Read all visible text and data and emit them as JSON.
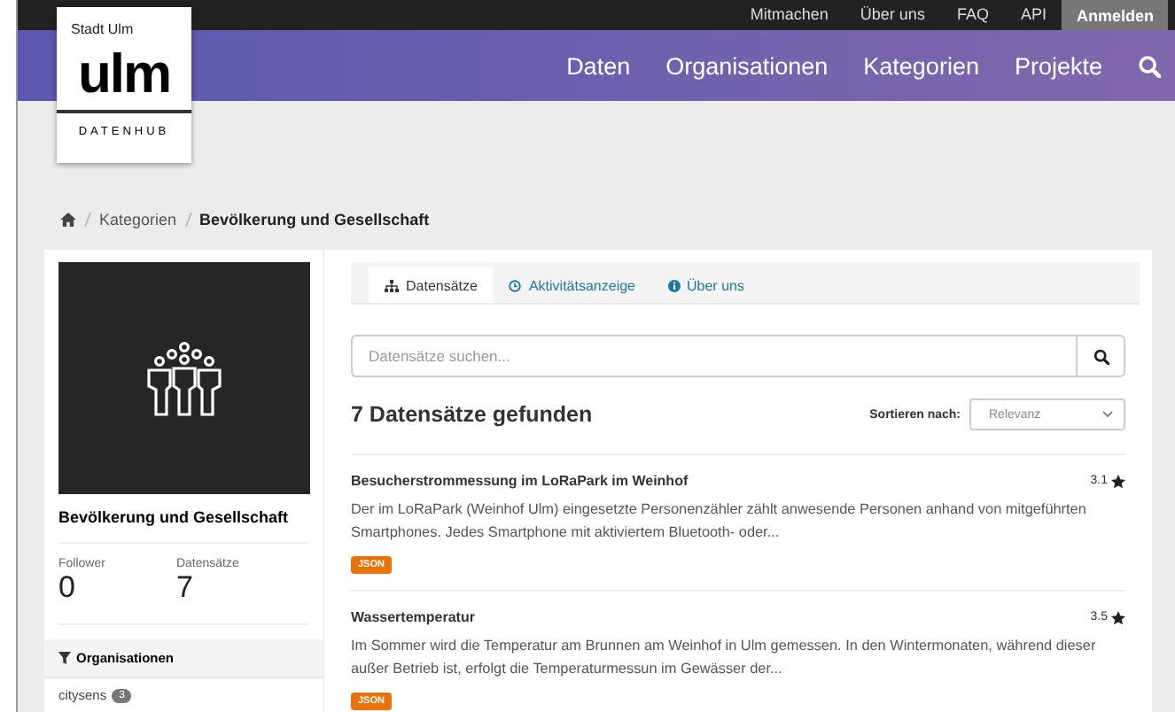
{
  "logo": {
    "top": "Stadt Ulm",
    "main": "ulm",
    "bottom": "DATENHUB"
  },
  "top_links": [
    {
      "label": "Mitmachen",
      "kind": "link"
    },
    {
      "label": "Über uns",
      "kind": "link"
    },
    {
      "label": "FAQ",
      "kind": "link"
    },
    {
      "label": "API",
      "kind": "link"
    },
    {
      "label": "Anmelden",
      "kind": "button"
    }
  ],
  "nav": [
    "Daten",
    "Organisationen",
    "Kategorien",
    "Projekte"
  ],
  "breadcrumb": [
    "Kategorien",
    "Bevölkerung und Gesellschaft"
  ],
  "sidebar": {
    "title": "Bevölkerung und Gesellschaft",
    "stats": [
      {
        "label": "Follower",
        "value": "0"
      },
      {
        "label": "Datensätze",
        "value": "7"
      }
    ],
    "facet": {
      "title": "Organisationen",
      "items": [
        {
          "label": "citysens",
          "count": "3"
        }
      ]
    }
  },
  "tabs": [
    {
      "label": "Datensätze",
      "selected": true
    },
    {
      "label": "Aktivitätsanzeige",
      "selected": false
    },
    {
      "label": "Über uns",
      "selected": false
    }
  ],
  "search": {
    "placeholder": "Datensätze suchen..."
  },
  "result_count": "7 Datensätze gefunden",
  "sort": {
    "label": "Sortieren nach:",
    "value": "Relevanz"
  },
  "datasets": [
    {
      "title": "Besucherstrommessung im LoRaPark im Weinhof",
      "rating": "3.1",
      "description": "Der im LoRaPark (Weinhof Ulm) eingesetzte Personenzähler zählt anwesende Personen anhand von mitgeführten Smartphones. Jedes Smartphone mit aktiviertem Bluetooth- oder...",
      "formats": [
        "JSON"
      ]
    },
    {
      "title": "Wassertemperatur",
      "rating": "3.5",
      "description": "Im Sommer wird die Temperatur am Brunnen am Weinhof in Ulm gemessen. In den Wintermonaten, während dieser außer Betrieb ist, erfolgt die Temperaturmessun im Gewässer der...",
      "formats": [
        "JSON"
      ]
    }
  ]
}
